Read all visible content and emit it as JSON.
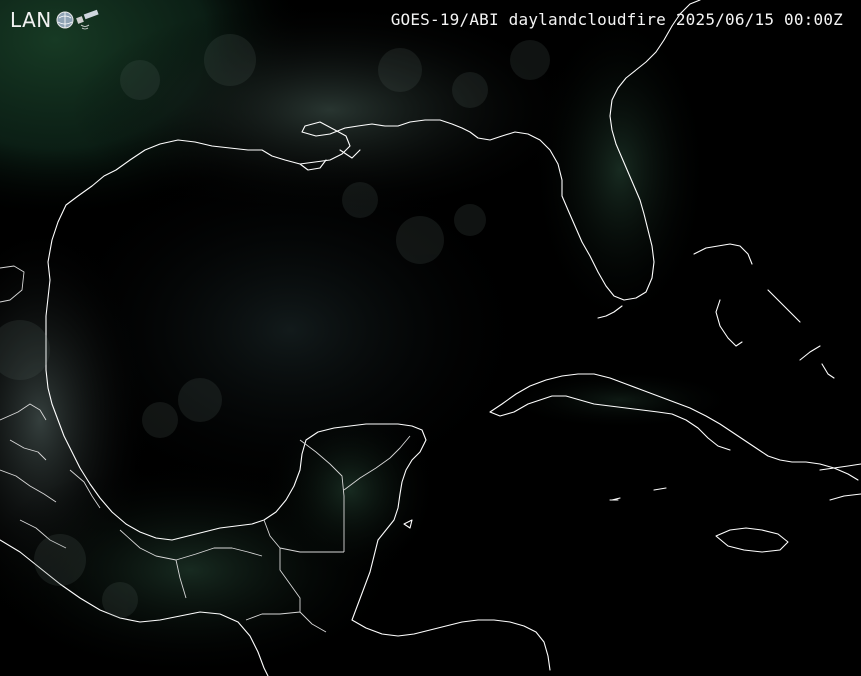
{
  "logo": {
    "text": "LAN",
    "icon": "satellite-globe-icon"
  },
  "header": {
    "title": "GOES-19/ABI daylandcloudfire 2025/06/15 00:00Z"
  },
  "colors": {
    "background": "#000000",
    "land_dark_green": "#0b2416",
    "coastline": "#ffffff",
    "text": "#f4f4f4"
  }
}
